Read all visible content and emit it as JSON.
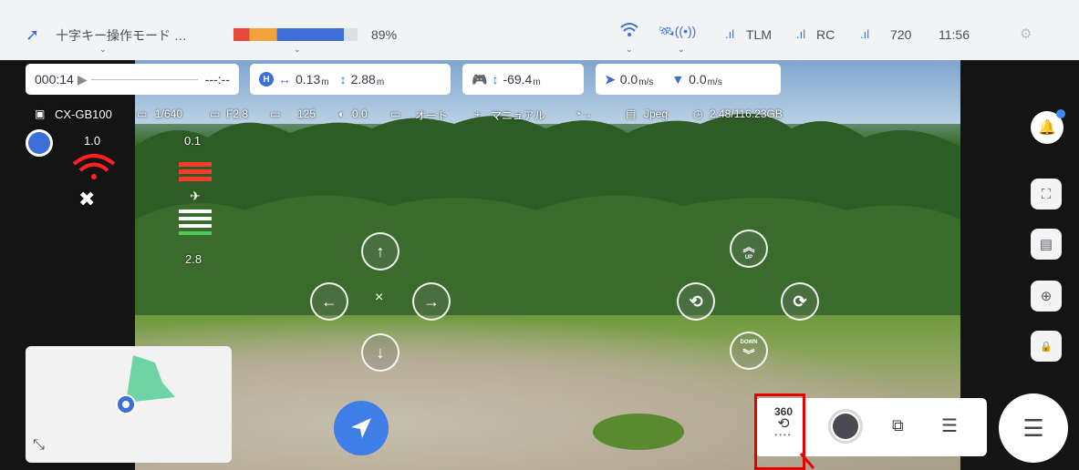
{
  "topbar": {
    "mode_label": "十字キー操作モード …",
    "battery_percent": "89%",
    "battery_level": 0.89,
    "tlm_label": "TLM",
    "rc_label": "RC",
    "resolution": "720",
    "clock": "11:56"
  },
  "telemetry": {
    "flight_time": "000:14",
    "remaining_time": "---:--",
    "horizontal_distance": "0.13",
    "horizontal_unit": "m",
    "height": "2.88",
    "height_unit": "m",
    "controller_altitude": "-69.4",
    "controller_unit": "m",
    "horizontal_speed": "0.0",
    "horizontal_speed_unit": "m/s",
    "vertical_speed": "0.0",
    "vertical_speed_unit": "m/s"
  },
  "camera": {
    "model": "CX-GB100",
    "shutter": "1/640",
    "aperture": "F2.8",
    "iso": "125",
    "ev": "0.0",
    "wb": "オート",
    "focus": "マニュアル",
    "format": "Jpeg",
    "storage": "2.48/116.23GB"
  },
  "left_panel": {
    "signal_value": "1.0",
    "obstacle_top": "0.1",
    "obstacle_bottom": "2.8"
  },
  "joystick": {
    "stop_mark": "×",
    "up_label": "UP",
    "down_label": "DOWN"
  },
  "controls": {
    "pano_label": "360"
  },
  "colors": {
    "accent_blue": "#3e7ee6",
    "highlight_red": "#e60000",
    "battery_red": "#e8483a",
    "battery_orange": "#f3a33a",
    "battery_blue": "#3d6fd8"
  }
}
